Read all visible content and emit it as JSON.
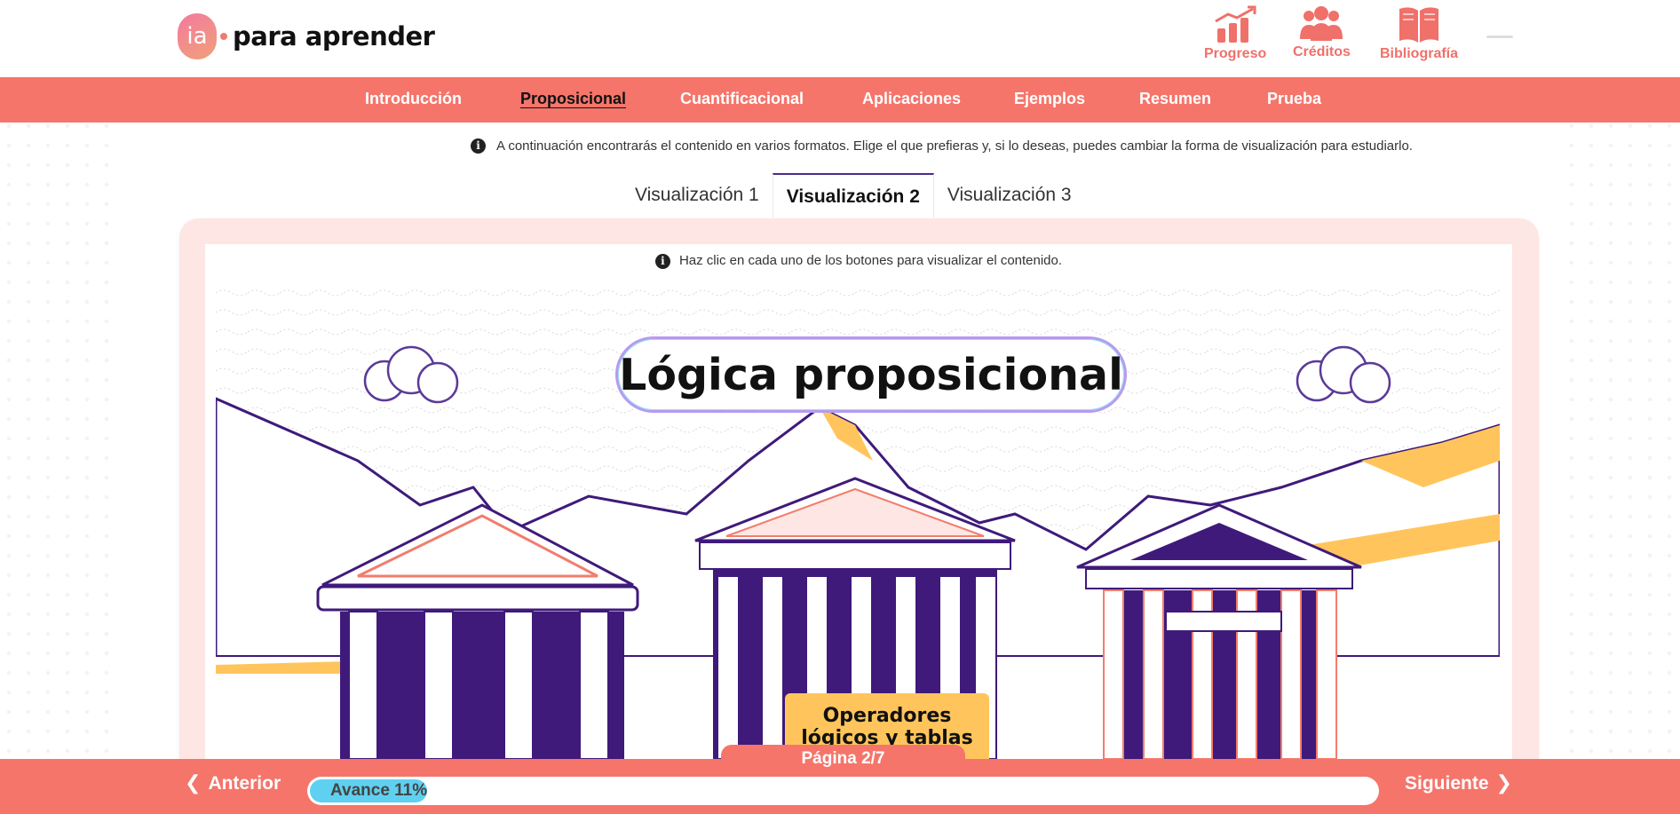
{
  "header": {
    "logo_badge": "ia",
    "logo_text": "para aprender",
    "actions": [
      {
        "label": "Progreso",
        "icon": "chart-up-icon"
      },
      {
        "label": "Créditos",
        "icon": "users-icon"
      },
      {
        "label": "Bibliografía",
        "icon": "book-icon"
      }
    ]
  },
  "nav": {
    "items": [
      {
        "label": "Introducción"
      },
      {
        "label": "Proposicional",
        "active": true
      },
      {
        "label": "Cuantificacional"
      },
      {
        "label": "Aplicaciones"
      },
      {
        "label": "Ejemplos"
      },
      {
        "label": "Resumen"
      },
      {
        "label": "Prueba"
      }
    ]
  },
  "main": {
    "info_text": "A continuación encontrarás el contenido en varios formatos. Elige el que prefieras y, si lo deseas, puedes cambiar la forma de visualización para estudiarlo.",
    "tabs": [
      {
        "label": "Visualización 1"
      },
      {
        "label": "Visualización 2",
        "active": true
      },
      {
        "label": "Visualización 3"
      }
    ],
    "inner_info_text": "Haz clic en cada uno de los botones para visualizar el contenido.",
    "scene_title": "Lógica proposicional",
    "scene_button": "Operadores lógicos y tablas de verdad"
  },
  "footer": {
    "page_label": "Página 2/7",
    "prev_label": "Anterior",
    "next_label": "Siguiente",
    "progress_label": "Avance 11%",
    "progress_value": 0.11
  },
  "colors": {
    "accent": "#f5756b",
    "frame": "#fde6e3",
    "purple": "#3f1a7a",
    "yellow": "#ffc55c",
    "progress": "#5fd0f0"
  }
}
